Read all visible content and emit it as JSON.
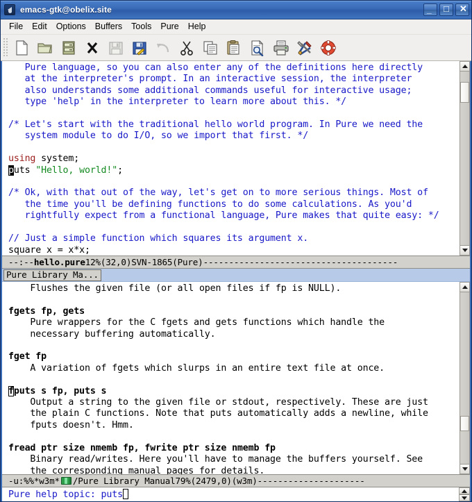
{
  "window": {
    "title": "emacs-gtk@obelix.site",
    "icon": "emacs-icon",
    "minimize_label": "_",
    "maximize_label": "□",
    "close_label": "✕"
  },
  "menubar": {
    "items": [
      {
        "label": "File",
        "name": "menu-file"
      },
      {
        "label": "Edit",
        "name": "menu-edit"
      },
      {
        "label": "Options",
        "name": "menu-options"
      },
      {
        "label": "Buffers",
        "name": "menu-buffers"
      },
      {
        "label": "Tools",
        "name": "menu-tools"
      },
      {
        "label": "Pure",
        "name": "menu-pure"
      },
      {
        "label": "Help",
        "name": "menu-help"
      }
    ]
  },
  "toolbar": {
    "buttons": [
      {
        "icon": "new-file-icon",
        "label": "New File",
        "disabled": false
      },
      {
        "icon": "open-folder-icon",
        "label": "Open File",
        "disabled": false
      },
      {
        "icon": "dired-icon",
        "label": "Open Directory",
        "disabled": false
      },
      {
        "icon": "close-x-icon",
        "label": "Close Buffer",
        "disabled": false
      },
      {
        "icon": "save-icon",
        "label": "Save Buffer",
        "disabled": true
      },
      {
        "icon": "save-as-icon",
        "label": "Save As",
        "disabled": false
      },
      {
        "icon": "undo-icon",
        "label": "Undo",
        "disabled": true
      },
      {
        "icon": "cut-icon",
        "label": "Cut",
        "disabled": false
      },
      {
        "icon": "copy-icon",
        "label": "Copy",
        "disabled": false
      },
      {
        "icon": "paste-icon",
        "label": "Paste",
        "disabled": false
      },
      {
        "icon": "search-icon",
        "label": "Search",
        "disabled": false
      },
      {
        "icon": "print-icon",
        "label": "Print Buffer",
        "disabled": false
      },
      {
        "icon": "preferences-icon",
        "label": "Preferences",
        "disabled": false
      },
      {
        "icon": "help-icon",
        "label": "Help",
        "disabled": false
      }
    ]
  },
  "editor_window": {
    "buffer_name": "hello.pure",
    "lines": [
      "   Pure language, so you can also enter any of the definitions here directly",
      "   at the interpreter's prompt. In an interactive session, the interpreter",
      "   also understands some additional commands useful for interactive usage;",
      "   type 'help' in the interpreter to learn more about this. */",
      "",
      "/* Let's start with the traditional hello world program. In Pure we need the",
      "   system module to do I/O, so we import that first. */",
      "",
      "using system;",
      "puts \"Hello, world!\";",
      "",
      "/* Ok, with that out of the way, let's get on to more serious things. Most of",
      "   the time you'll be defining functions to do some calculations. As you'd",
      "   rightfully expect from a functional language, Pure makes that quite easy: */",
      "",
      "// Just a simple function which squares its argument x.",
      "square x = x*x;"
    ],
    "cursor_char": "p",
    "modeline": {
      "status": "--:--",
      "buffer": "hello.pure",
      "percent": "12%",
      "position": "(32,0)",
      "version": "SVN-1865",
      "mode": "(Pure)",
      "filler": "--------------------------------------"
    },
    "scrollbar": {
      "thumb_top_pct": 6,
      "thumb_height_pct": 12
    }
  },
  "w3m_window": {
    "tab_label": "Pure Library Ma...",
    "lines": [
      "    Flushes the given file (or all open files if fp is NULL).",
      "",
      "fgets fp, gets",
      "    Pure wrappers for the C fgets and gets functions which handle the",
      "    necessary buffering automatically.",
      "",
      "fget fp",
      "    A variation of fgets which slurps in an entire text file at once.",
      "",
      "fputs s fp, puts s",
      "    Output a string to the given file or stdout, respectively. These are just",
      "    the plain C functions. Note that puts automatically adds a newline, while",
      "    fputs doesn't. Hmm.",
      "",
      "fread ptr size nmemb fp, fwrite ptr size nmemb fp",
      "    Binary read/writes. Here you'll have to manage the buffers yourself. See",
      "    the corresponding manual pages for details."
    ],
    "cursor_char": "f",
    "modeline": {
      "status": "-u:%%",
      "buffer": "*w3m*",
      "icon": "w3m-icon",
      "separator": "/",
      "page_title": "Pure Library Manual",
      "percent": "79%",
      "position": "(2479,0)",
      "mode": "(w3m)",
      "filler": "---------------------"
    },
    "scrollbar": {
      "thumb_top_pct": 72,
      "thumb_height_pct": 9
    }
  },
  "minibuffer": {
    "prompt": "Pure help topic: ",
    "value": "puts"
  },
  "colors": {
    "titlebar": "#3a6cb8",
    "comment": "#1818c8",
    "keyword": "#9b1b1b",
    "string": "#138a20",
    "modeline_bg": "#d3d1cb",
    "tabline_bg": "#b7cae8",
    "toolbar_bg": "#f0efed"
  }
}
